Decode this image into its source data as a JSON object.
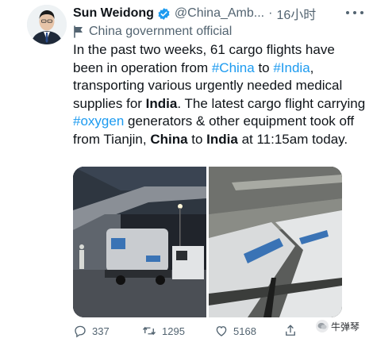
{
  "author": {
    "display_name": "Sun Weidong",
    "handle": "@China_Amb...",
    "separator": "·",
    "time": "16小时",
    "label": "China government official"
  },
  "tweet": {
    "segments": [
      {
        "text": "In the past two weeks, 61 cargo flights have been in operation from ",
        "style": "normal"
      },
      {
        "text": "#China",
        "style": "tag"
      },
      {
        "text": " to ",
        "style": "normal"
      },
      {
        "text": "#India",
        "style": "tag"
      },
      {
        "text": ", transporting various urgently needed medical supplies for ",
        "style": "normal"
      },
      {
        "text": "India",
        "style": "bold"
      },
      {
        "text": ". The latest cargo flight carrying ",
        "style": "normal"
      },
      {
        "text": "#oxygen",
        "style": "tag"
      },
      {
        "text": " generators & other equipment took off from Tianjin, ",
        "style": "normal"
      },
      {
        "text": "China",
        "style": "bold"
      },
      {
        "text": " to ",
        "style": "normal"
      },
      {
        "text": "India",
        "style": "bold"
      },
      {
        "text": " at 11:15am today.",
        "style": "normal"
      }
    ]
  },
  "media": {
    "images": [
      "photo-left",
      "photo-right"
    ]
  },
  "actions": {
    "reply_count": "337",
    "retweet_count": "1295",
    "like_count": "5168"
  },
  "watermark": {
    "text": "牛弹琴"
  },
  "colors": {
    "link": "#1d9bf0",
    "verified": "#1d9bf0",
    "muted": "#536471"
  }
}
